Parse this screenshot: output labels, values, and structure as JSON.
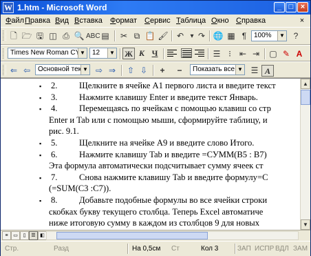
{
  "window": {
    "title": "1.htm - Microsoft Word",
    "icon_letter": "W",
    "controls": {
      "minimize": "_",
      "maximize": "□",
      "close": "×"
    }
  },
  "menu": {
    "items": [
      "Файл",
      "Правка",
      "Вид",
      "Вставка",
      "Формат",
      "Сервис",
      "Таблица",
      "Окно",
      "Справка"
    ],
    "close_doc": "×"
  },
  "standard_toolbar": {
    "zoom": "100%"
  },
  "formatting_toolbar": {
    "font": "Times New Roman CYR",
    "size": "12",
    "bold": "Ж",
    "italic": "К",
    "underline": "Ч"
  },
  "web_toolbar": {
    "style": "Основной текст",
    "show": "Показать все"
  },
  "document": {
    "lines": [
      {
        "bullet": "▪",
        "num": "2.",
        "text": "Щелкните в ячейке A1 первого листа и введите текст"
      },
      {
        "bullet": "▪",
        "num": "3.",
        "text": "Нажмите клавишу Enter и введите текст Январь."
      },
      {
        "bullet": "▪",
        "num": "4.",
        "text": "Перемещаясь по ячейкам с помощью клавиш со стр"
      },
      {
        "cont": "Enter и Tab или с помощью мыши, сформируйте таблицу, и"
      },
      {
        "cont": "рис. 9.1."
      },
      {
        "bullet": "▪",
        "num": "5.",
        "text": "Щелкните на ячейке A9 и введите слово Итого."
      },
      {
        "bullet": "▪",
        "num": "6.",
        "text": "Нажмите клавишу Tab и введите =СУММ(B5 : B7)"
      },
      {
        "cont": "Эта формула автоматически подсчитывает сумму ячеек ст"
      },
      {
        "bullet": "▪",
        "num": "7.",
        "text": "Снова нажмите клавишу Tab и введите формулу=С"
      },
      {
        "cont": "(=SUM(C3 :C7))."
      },
      {
        "bullet": "▪",
        "num": "8.",
        "text": "Добавьте подобные формулы во все ячейки строки"
      },
      {
        "cont": "скобках букву текущего столбца. Теперь Excel автоматиче"
      },
      {
        "cont": "ниже итоговую сумму в каждом из столбцов 9 для новых"
      }
    ]
  },
  "status": {
    "page": "Стр.",
    "section": "Разд",
    "position": "На 0,5см",
    "line": "Ст",
    "column": "Кол 3",
    "rec": "ЗАП",
    "trk": "ИСПР",
    "ext": "ВДЛ",
    "ovr": "ЗАМ"
  }
}
